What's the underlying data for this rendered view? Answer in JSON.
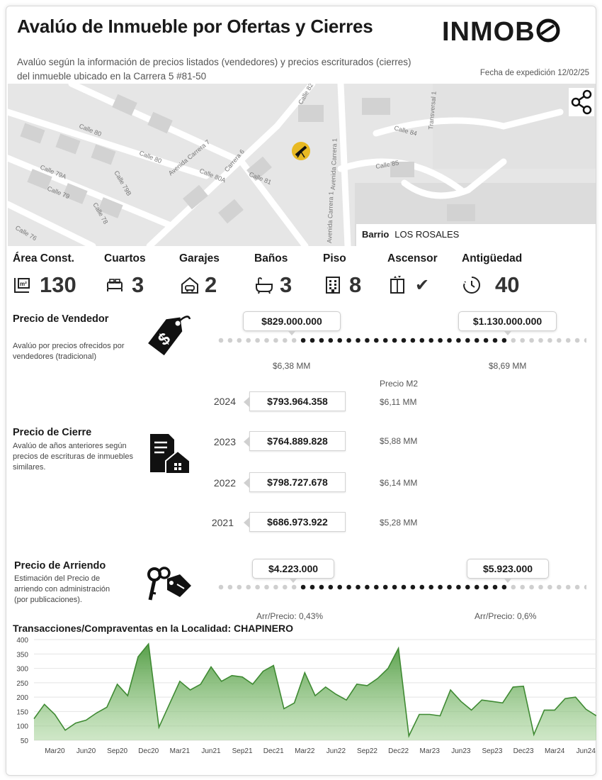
{
  "header": {
    "title": "Avalúo de Inmueble por Ofertas y Cierres",
    "logo_text": "INMOB",
    "subtitle": "Avalúo según la información de precios listados (vendedores) y precios escriturados (cierres) del inmueble ubicado en la Carrera 5 #81-50",
    "date": "Fecha de expedición 12/02/25"
  },
  "map": {
    "streets": [
      "Calle 80",
      "Calle 80",
      "Calle 79A",
      "Calle 79",
      "Calle 78",
      "Calle 79B",
      "Avenida Carrera 7",
      "Calle 80A",
      "Calle 81",
      "Carrera 6",
      "Avenida Carrera 1",
      "Avenida Carrera 1",
      "Calle 84",
      "Calle 85",
      "Transversal 1",
      "Calle 82",
      "Calle 76"
    ],
    "barrio_label": "Barrio",
    "barrio_value": "LOS ROSALES",
    "marker_icon": "telescope-icon",
    "share_icon": "share-icon"
  },
  "stats": [
    {
      "label": "Área Const.",
      "value": "130",
      "icon": "area-icon"
    },
    {
      "label": "Cuartos",
      "value": "3",
      "icon": "bed-icon"
    },
    {
      "label": "Garajes",
      "value": "2",
      "icon": "garage-icon"
    },
    {
      "label": "Baños",
      "value": "3",
      "icon": "bathtub-icon"
    },
    {
      "label": "Piso",
      "value": "8",
      "icon": "building-icon"
    },
    {
      "label": "Ascensor",
      "value": "✔",
      "icon": "elevator-icon"
    },
    {
      "label": "Antigüedad",
      "value": "40",
      "icon": "clock-icon"
    }
  ],
  "vendedor": {
    "title": "Precio de Vendedor",
    "desc": "Avalúo por precios ofrecidos por vendedores (tradicional)",
    "min": "$829.000.000",
    "max": "$1.130.000.000",
    "min_m2": "$6,38 MM",
    "max_m2": "$8,69 MM",
    "icon": "price-tag-icon"
  },
  "cierre": {
    "title": "Precio de Cierre",
    "desc": "Avalúo de años anteriores según precios de escrituras de inmuebles similares.",
    "m2_header": "Precio M2",
    "icon": "deed-house-icon",
    "rows": [
      {
        "year": "2024",
        "price": "$793.964.358",
        "m2": "$6,11 MM"
      },
      {
        "year": "2023",
        "price": "$764.889.828",
        "m2": "$5,88 MM"
      },
      {
        "year": "2022",
        "price": "$798.727.678",
        "m2": "$6,14 MM"
      },
      {
        "year": "2021",
        "price": "$686.973.922",
        "m2": "$5,28 MM"
      }
    ]
  },
  "arriendo": {
    "title": "Precio de Arriendo",
    "desc": "Estimación del Precio de arriendo con administración (por publicaciones).",
    "min": "$4.223.000",
    "max": "$5.923.000",
    "min_ratio": "Arr/Precio: 0,43%",
    "max_ratio": "Arr/Precio: 0,6%",
    "icon": "keys-icon"
  },
  "chart_data": {
    "type": "area",
    "title": "Transacciones/Compraventas en la Localidad: CHAPINERO",
    "xlabel": "",
    "ylabel": "",
    "ylim": [
      50,
      400
    ],
    "yticks": [
      50,
      100,
      150,
      200,
      250,
      300,
      350,
      400
    ],
    "grid": true,
    "color": "#5a9e4b",
    "x": [
      "Ene20",
      "Feb20",
      "Mar20",
      "Abr20",
      "May20",
      "Jun20",
      "Jul20",
      "Ago20",
      "Sep20",
      "Oct20",
      "Nov20",
      "Dic20",
      "Ene21",
      "Feb21",
      "Mar21",
      "Abr21",
      "May21",
      "Jun21",
      "Jul21",
      "Ago21",
      "Sep21",
      "Oct21",
      "Nov21",
      "Dic21",
      "Ene22",
      "Feb22",
      "Mar22",
      "Abr22",
      "May22",
      "Jun22",
      "Jul22",
      "Ago22",
      "Sep22",
      "Oct22",
      "Nov22",
      "Dic22",
      "Ene23",
      "Feb23",
      "Mar23",
      "Abr23",
      "May23",
      "Jun23",
      "Jul23",
      "Ago23",
      "Sep23",
      "Oct23",
      "Nov23",
      "Dic23",
      "Ene24",
      "Feb24",
      "Mar24",
      "Abr24",
      "May24",
      "Jun24",
      "Jul24"
    ],
    "values": [
      125,
      175,
      140,
      85,
      110,
      120,
      145,
      165,
      245,
      205,
      340,
      385,
      95,
      175,
      255,
      225,
      245,
      305,
      255,
      275,
      270,
      245,
      290,
      310,
      160,
      180,
      285,
      205,
      235,
      210,
      190,
      245,
      240,
      265,
      300,
      370,
      65,
      140,
      140,
      135,
      225,
      185,
      155,
      190,
      185,
      180,
      235,
      238,
      70,
      155,
      155,
      195,
      200,
      158,
      135
    ],
    "tick_labels": [
      "Mar20",
      "Jun20",
      "Sep20",
      "Dec20",
      "Mar21",
      "Jun21",
      "Sep21",
      "Dec21",
      "Mar22",
      "Jun22",
      "Sep22",
      "Dec22",
      "Mar23",
      "Jun23",
      "Sep23",
      "Dec23",
      "Mar24",
      "Jun24"
    ],
    "tick_indices": [
      2,
      5,
      8,
      11,
      14,
      17,
      20,
      23,
      26,
      29,
      32,
      35,
      38,
      41,
      44,
      47,
      50,
      53
    ]
  }
}
